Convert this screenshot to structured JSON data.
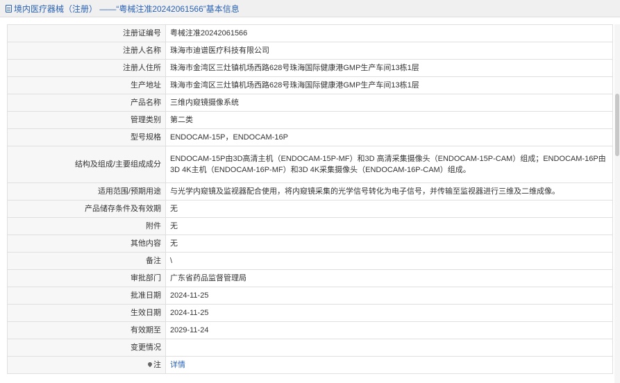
{
  "header": {
    "title": "境内医疗器械（注册） ——“粤械注准20242061566”基本信息"
  },
  "rows": [
    {
      "label": "注册证编号",
      "value": "粤械注准20242061566"
    },
    {
      "label": "注册人名称",
      "value": "珠海市迪谱医疗科技有限公司"
    },
    {
      "label": "注册人住所",
      "value": "珠海市金湾区三灶镇机场西路628号珠海国际健康港GMP生产车间13栋1层"
    },
    {
      "label": "生产地址",
      "value": "珠海市金湾区三灶镇机场西路628号珠海国际健康港GMP生产车间13栋1层"
    },
    {
      "label": "产品名称",
      "value": "三维内窥镜摄像系统"
    },
    {
      "label": "管理类别",
      "value": "第二类"
    },
    {
      "label": "型号规格",
      "value": "ENDOCAM-15P，ENDOCAM-16P"
    },
    {
      "label": "结构及组成/主要组成成分",
      "value": "ENDOCAM-15P由3D高清主机（ENDOCAM-15P-MF）和3D 高清采集摄像头（ENDOCAM-15P-CAM）组成；ENDOCAM-16P由3D 4K主机（ENDOCAM-16P-MF）和3D 4K采集摄像头（ENDOCAM-16P-CAM）组成。"
    },
    {
      "label": "适用范围/预期用途",
      "value": "与光学内窥镜及监视器配合使用，将内窥镜采集的光学信号转化为电子信号，并传输至监视器进行三维及二维成像。"
    },
    {
      "label": "产品储存条件及有效期",
      "value": "无"
    },
    {
      "label": "附件",
      "value": "无"
    },
    {
      "label": "其他内容",
      "value": "无"
    },
    {
      "label": "备注",
      "value": "\\"
    },
    {
      "label": "审批部门",
      "value": "广东省药品监督管理局"
    },
    {
      "label": "批准日期",
      "value": "2024-11-25"
    },
    {
      "label": "生效日期",
      "value": "2024-11-25"
    },
    {
      "label": "有效期至",
      "value": "2029-11-24"
    },
    {
      "label": "变更情况",
      "value": ""
    }
  ],
  "note_row": {
    "label": "注",
    "icon": "pin-icon",
    "link_text": "详情"
  }
}
